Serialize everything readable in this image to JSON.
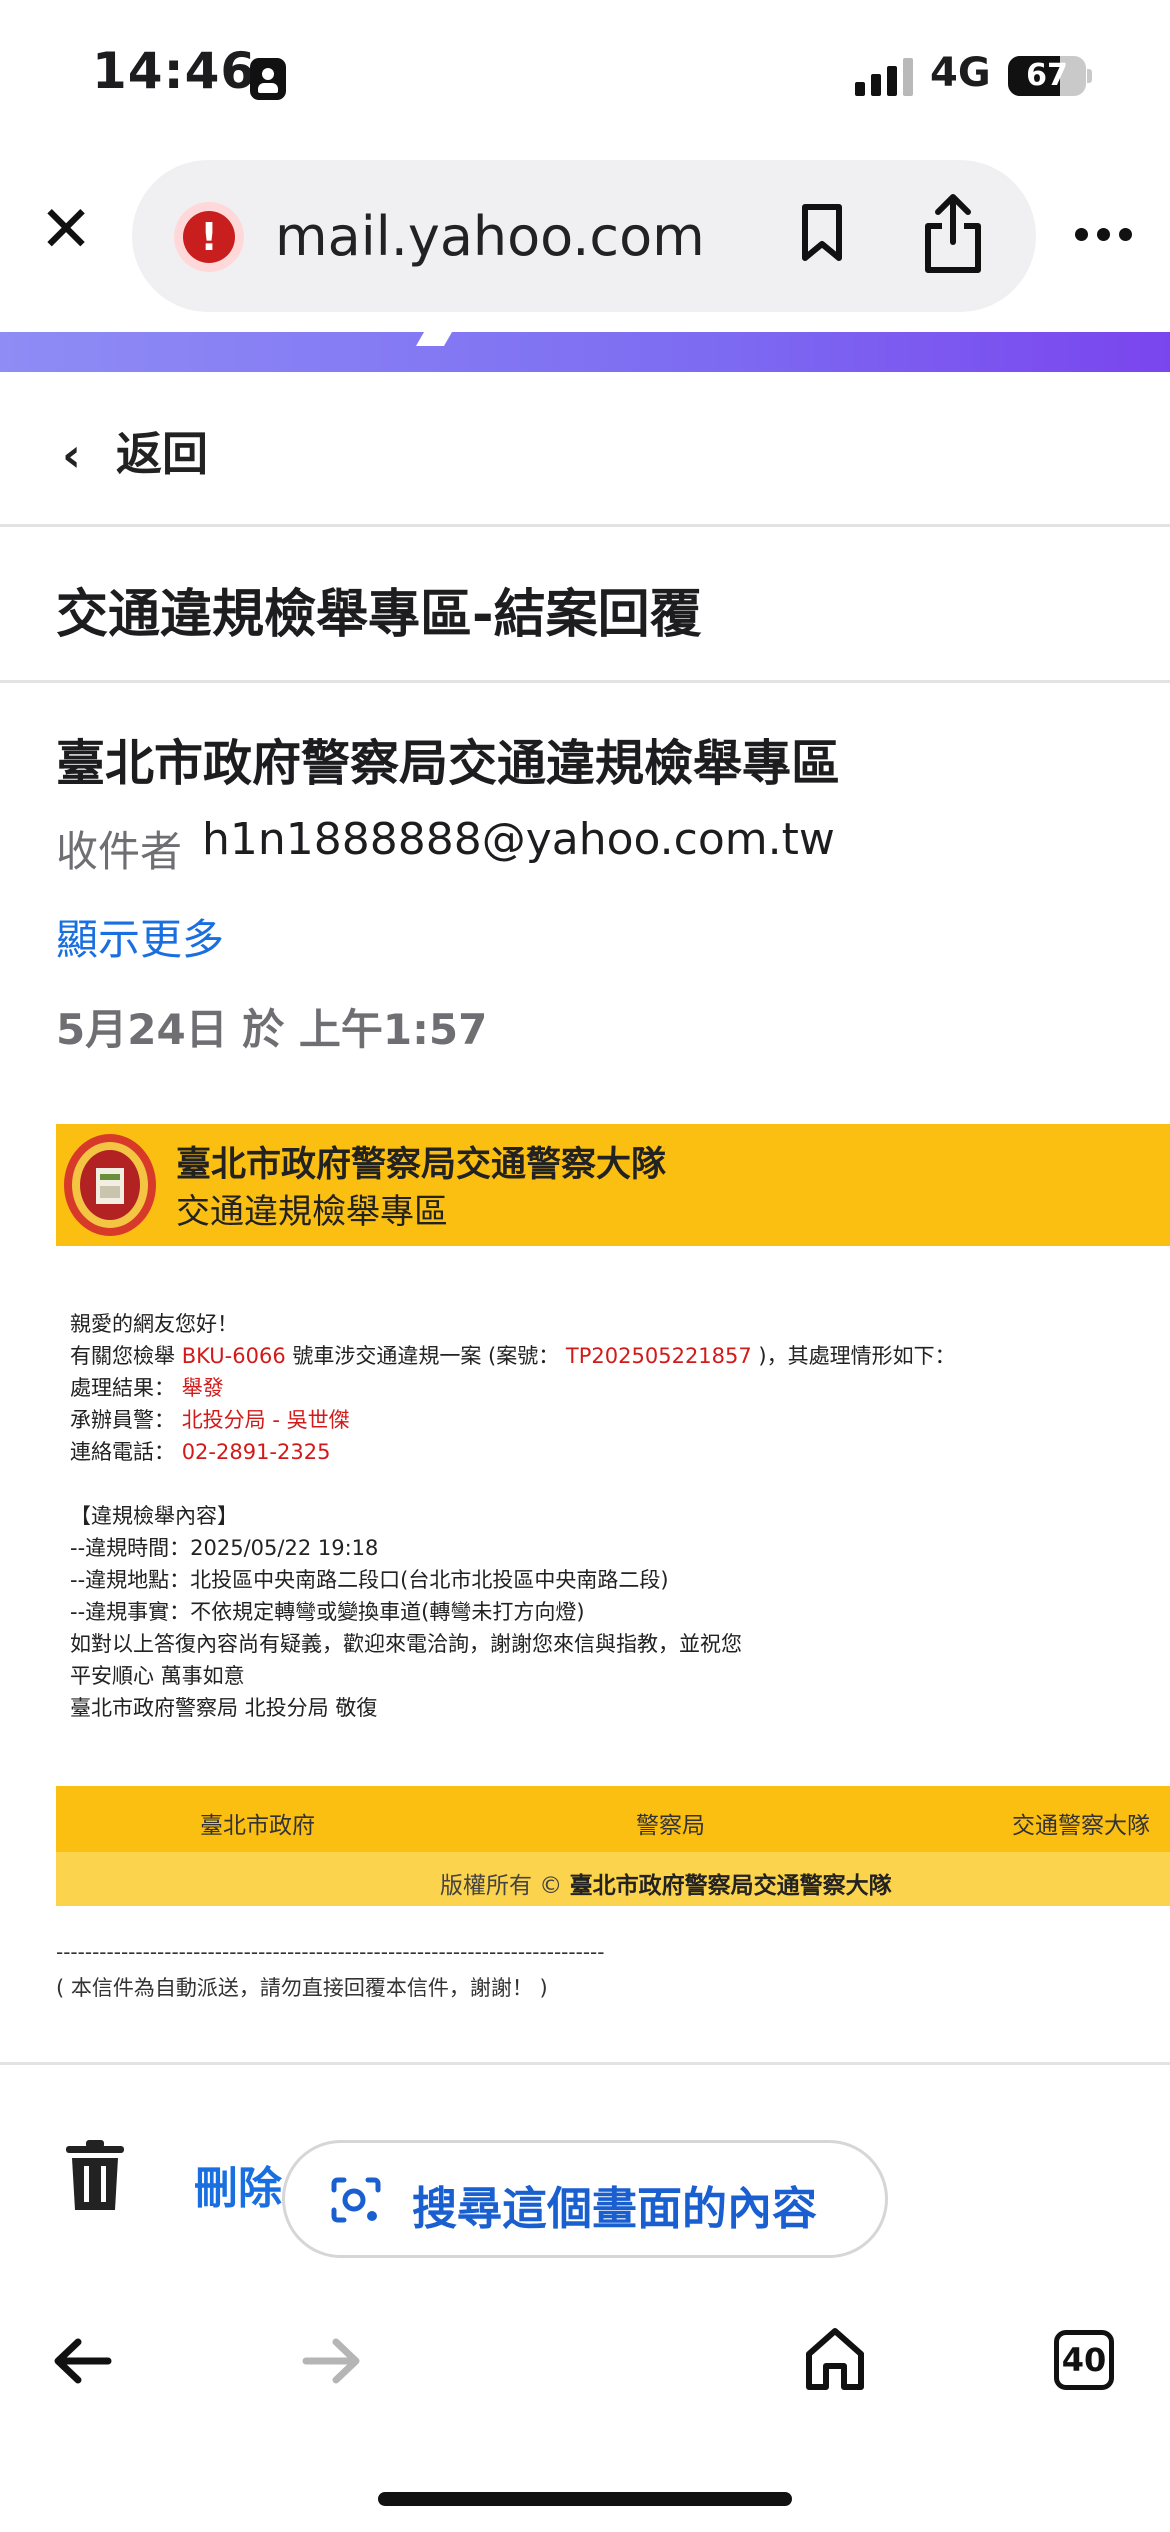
{
  "status_bar": {
    "time": "14:46",
    "network": "4G",
    "battery": "67",
    "battery_level_percent": 67
  },
  "browser": {
    "url": "mail.yahoo.com",
    "security_icon": "warning-icon",
    "icons": [
      "close-icon",
      "bookmark-icon",
      "share-icon",
      "more-icon"
    ]
  },
  "mail_nav": {
    "back_label": "返回"
  },
  "email": {
    "subject": "交通違規檢舉專區-結案回覆",
    "sender": "臺北市政府警察局交通違規檢舉專區",
    "to_label": "收件者",
    "to_address": "h1n1888888@yahoo.com.tw",
    "show_more": "顯示更多",
    "date": "5月24日 於 上午1:57"
  },
  "email_body": {
    "header_title": "臺北市政府警察局交通警察大隊",
    "header_subtitle": "交通違規檢舉專區",
    "greeting": "親愛的網友您好！",
    "line1_prefix": "有關您檢舉 ",
    "plate": "BKU-6066",
    "line1_mid": " 號車涉交通違規一案 (案號： ",
    "case_no": "TP202505221857",
    "line1_suffix": " )，其處理情形如下：",
    "result_label": "處理結果：",
    "result_value": "舉發",
    "officer_label": "承辦員警：",
    "officer_value": "北投分局 - 吳世傑",
    "phone_label": "連絡電話：",
    "phone_value": "02-2891-2325",
    "content_heading": "【違規檢舉內容】",
    "detail_time": "--違規時間：2025/05/22 19:18",
    "detail_place": "--違規地點：北投區中央南路二段口(台北市北投區中央南路二段)",
    "detail_fact": "--違規事實：不依規定轉彎或變換車道(轉彎未打方向燈)",
    "closing1": "如對以上答復內容尚有疑義，歡迎來電洽詢，謝謝您來信與指教，並祝您",
    "closing2": "平安順心 萬事如意",
    "closing3": "臺北市政府警察局 北投分局 敬復"
  },
  "email_footer": {
    "links": [
      "臺北市政府",
      "警察局",
      "交通警察大隊"
    ],
    "copyright_prefix": "版權所有 © ",
    "copyright_org": "臺北市政府警察局交通警察大隊",
    "dash_line": "----------------------------------------------------------------------------",
    "auto_note": "( 本信件為自動派送，請勿直接回覆本信件，謝謝！ )"
  },
  "toolbar": {
    "delete_label": "刪除",
    "search_screen_label": "搜尋這個畫面的內容"
  },
  "bottom_nav": {
    "tab_count": "40"
  },
  "colors": {
    "link_blue": "#1a6fe0",
    "header_yellow": "#fbbf12",
    "alert_red": "#d21a1a"
  }
}
